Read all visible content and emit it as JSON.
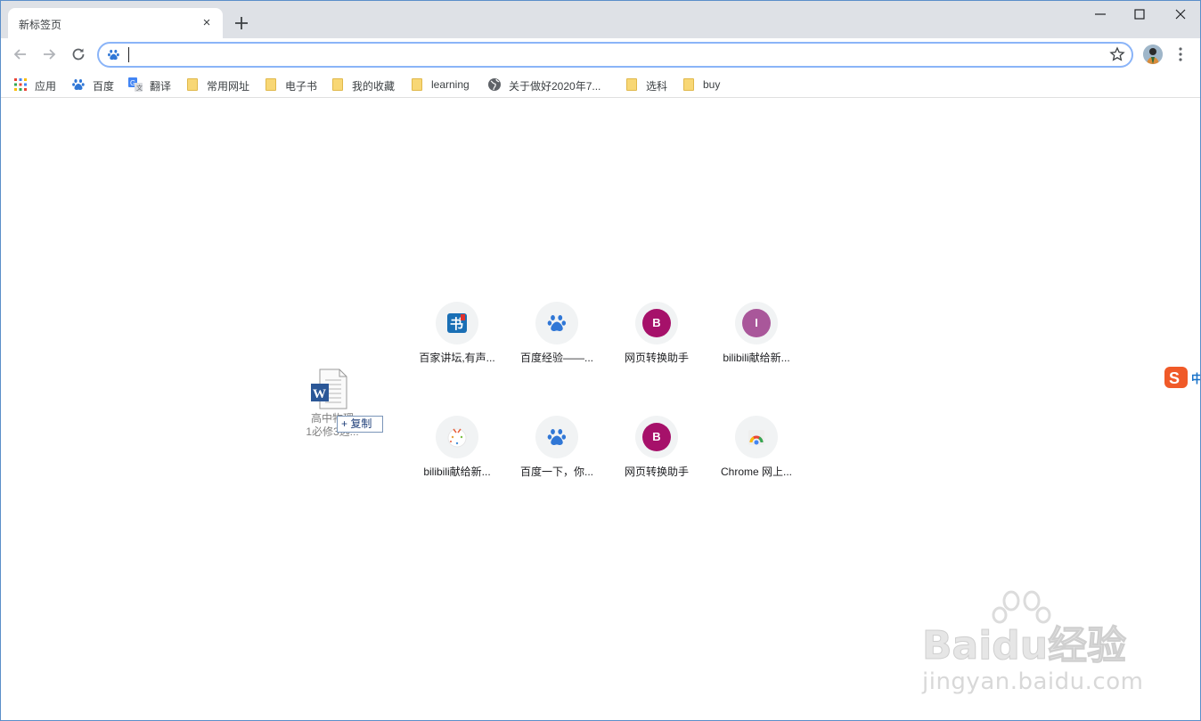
{
  "tab": {
    "title": "新标签页",
    "close": "×"
  },
  "omnibox": {
    "value": ""
  },
  "bookmarks": [
    {
      "label": "应用",
      "icon": "apps-grid-icon"
    },
    {
      "label": "百度",
      "icon": "baidu-paw-icon"
    },
    {
      "label": "翻译",
      "icon": "translate-icon"
    },
    {
      "label": "常用网址",
      "icon": "folder-icon"
    },
    {
      "label": "电子书",
      "icon": "folder-icon"
    },
    {
      "label": "我的收藏",
      "icon": "folder-icon"
    },
    {
      "label": "learning",
      "icon": "folder-icon"
    },
    {
      "label": "关于做好2020年7...",
      "icon": "globe-icon"
    },
    {
      "label": "选科",
      "icon": "folder-icon"
    },
    {
      "label": "buy",
      "icon": "folder-icon"
    }
  ],
  "shortcuts": [
    {
      "label": "百家讲坛,有声...",
      "icon": "book-icon",
      "letter": "书",
      "color": "#1a6fb5"
    },
    {
      "label": "百度经验——...",
      "icon": "baidu-paw-icon",
      "letter": "",
      "color": "#3366cc"
    },
    {
      "label": "网页转换助手",
      "icon": "letter-b-icon",
      "letter": "B",
      "color": "#a6116a"
    },
    {
      "label": "bilibili献给新...",
      "icon": "letter-i-icon",
      "letter": "I",
      "color": "#a9579a"
    },
    {
      "label": "bilibili献给新...",
      "icon": "bilibili-tv-icon",
      "letter": "",
      "color": "#f1f3f4"
    },
    {
      "label": "百度一下，你...",
      "icon": "baidu-paw-icon",
      "letter": "",
      "color": "#3366cc"
    },
    {
      "label": "网页转换助手",
      "icon": "letter-b-icon",
      "letter": "B",
      "color": "#a6116a"
    },
    {
      "label": "Chrome 网上...",
      "icon": "chrome-webstore-icon",
      "letter": "",
      "color": "#f1f3f4"
    }
  ],
  "drag": {
    "filename_line1": "高中物理",
    "filename_line2": "1必修3选...",
    "copy_label": "+ 复制"
  },
  "ime": {
    "label": "中"
  },
  "watermark": {
    "brand": "Baidu经验",
    "url": "jingyan.baidu.com"
  }
}
